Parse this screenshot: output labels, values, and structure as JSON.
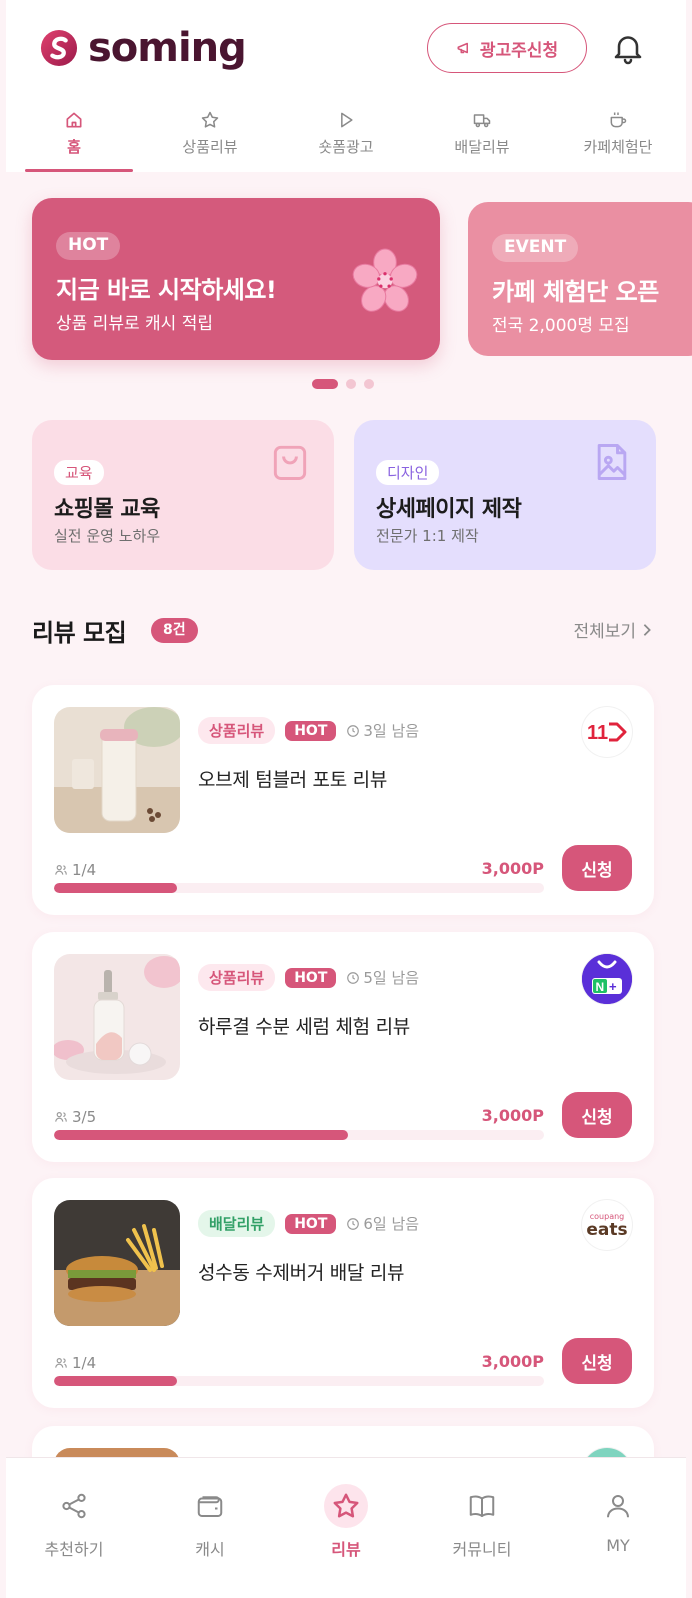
{
  "app": {
    "name": "soming"
  },
  "header": {
    "ad_button_label": "광고주신청"
  },
  "tabs": [
    {
      "label": "홈",
      "icon": "home-icon",
      "active": true
    },
    {
      "label": "상품리뷰",
      "icon": "star-icon",
      "active": false
    },
    {
      "label": "숏폼광고",
      "icon": "play-icon",
      "active": false
    },
    {
      "label": "배달리뷰",
      "icon": "truck-icon",
      "active": false
    },
    {
      "label": "카페체험단",
      "icon": "coffee-cup-icon",
      "active": false
    }
  ],
  "banners": [
    {
      "tag": "HOT",
      "title": "지금 바로 시작하세요!",
      "subtitle": "상품 리뷰로 캐시 적립",
      "color": "#d45a7c"
    },
    {
      "tag": "EVENT",
      "title": "카페 체험단 오픈",
      "subtitle": "전국 2,000명 모집",
      "color": "#ea8fa2"
    }
  ],
  "carousel": {
    "total": 3,
    "current": 1
  },
  "promos": [
    {
      "tag": "교육",
      "title": "쇼핑몰 교육",
      "subtitle": "실전 운영 노하우",
      "icon": "shopping-bag-icon"
    },
    {
      "tag": "디자인",
      "title": "상세페이지 제작",
      "subtitle": "전문가 1:1 제작",
      "icon": "image-file-icon"
    }
  ],
  "reviews_section": {
    "title": "리뷰 모집",
    "count_badge": "8건",
    "see_all": "전체보기"
  },
  "reviews": [
    {
      "category": "상품리뷰",
      "category_type": "product",
      "hot": "HOT",
      "days_left": "3일 남음",
      "title": "오브제 텀블러 포토 리뷰",
      "slots": "1/4",
      "progress": 0.25,
      "points": "3,000P",
      "apply": "신청",
      "platform": "11st-logo",
      "thumb": "tumbler-photo"
    },
    {
      "category": "상품리뷰",
      "category_type": "product",
      "hot": "HOT",
      "days_left": "5일 남음",
      "title": "하루결 수분 세럼 체험 리뷰",
      "slots": "3/5",
      "progress": 0.6,
      "points": "3,000P",
      "apply": "신청",
      "platform": "naver-plus-logo",
      "thumb": "serum-photo"
    },
    {
      "category": "배달리뷰",
      "category_type": "delivery",
      "hot": "HOT",
      "days_left": "6일 남음",
      "title": "성수동 수제버거 배달 리뷰",
      "slots": "1/4",
      "progress": 0.25,
      "points": "3,000P",
      "apply": "신청",
      "platform": "coupang-eats-logo",
      "platform_text_top": "coupang",
      "platform_text": "eats",
      "thumb": "burger-photo"
    }
  ],
  "bottom_nav": [
    {
      "label": "추천하기",
      "icon": "share-icon",
      "active": false
    },
    {
      "label": "캐시",
      "icon": "wallet-icon",
      "active": false
    },
    {
      "label": "리뷰",
      "icon": "star-icon",
      "active": true
    },
    {
      "label": "커뮤니티",
      "icon": "book-icon",
      "active": false
    },
    {
      "label": "MY",
      "icon": "user-icon",
      "active": false
    }
  ],
  "colors": {
    "accent": "#d6567a",
    "background": "#fdf3f6",
    "delivery": "#32a067"
  }
}
